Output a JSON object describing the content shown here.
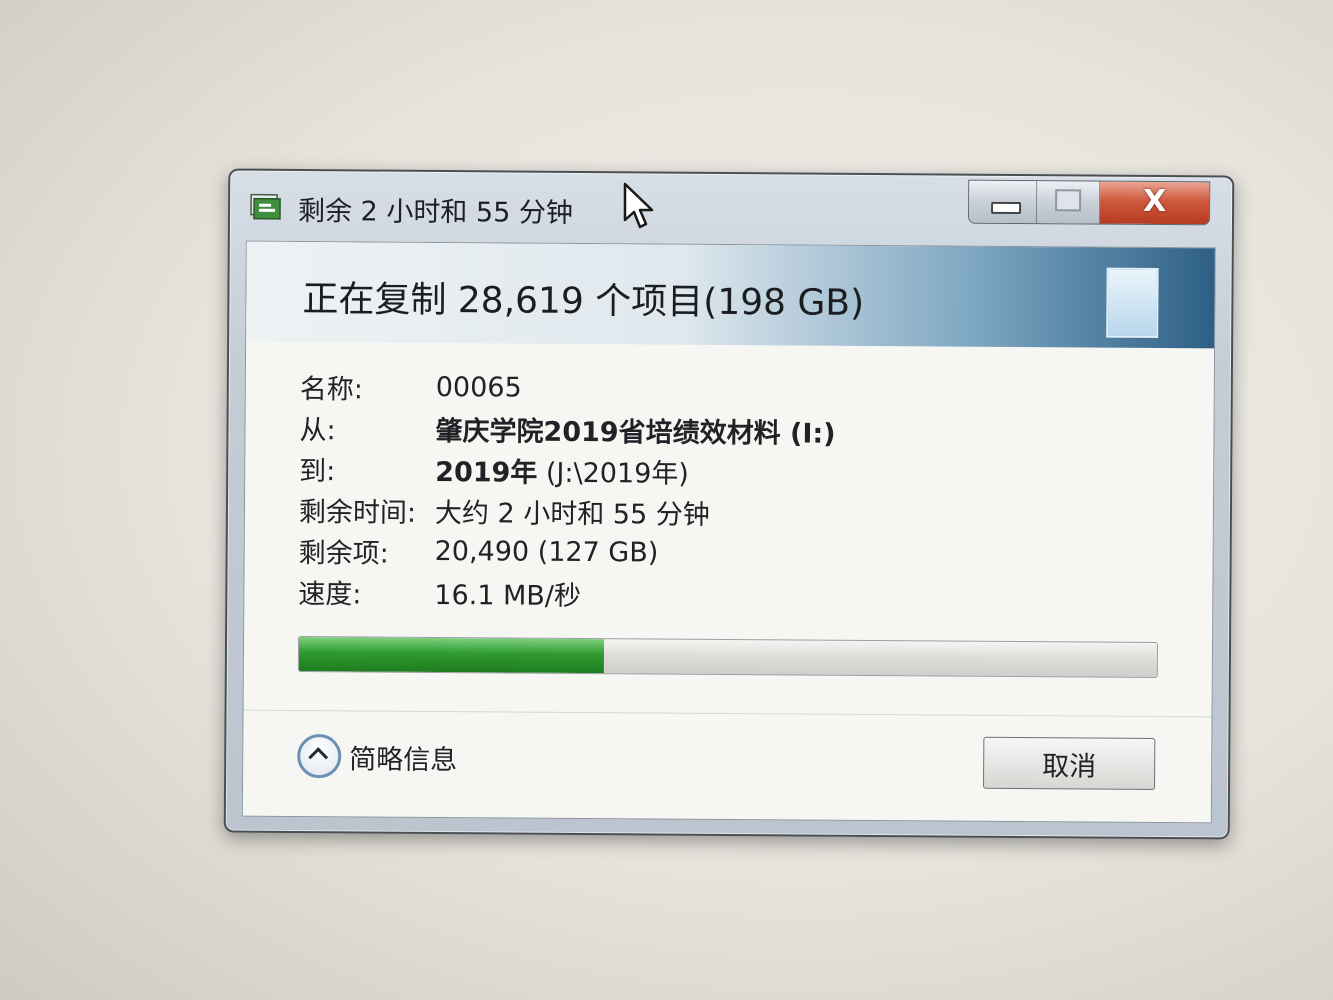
{
  "window": {
    "title": "剩余 2 小时和 55 分钟",
    "header_title": "正在复制 28,619 个项目(198 GB)",
    "close_glyph": "X"
  },
  "details": {
    "rows": [
      {
        "label": "名称:",
        "value": "00065",
        "bold": ""
      },
      {
        "label": "从:",
        "value": "",
        "bold": "肇庆学院2019省培绩效材料 (I:)"
      },
      {
        "label": "到:",
        "value": " (J:\\2019年)",
        "bold": "2019年"
      },
      {
        "label": "剩余时间:",
        "value": "大约 2 小时和 55 分钟",
        "bold": ""
      },
      {
        "label": "剩余项:",
        "value": "20,490 (127 GB)",
        "bold": ""
      },
      {
        "label": "速度:",
        "value": "16.1 MB/秒",
        "bold": ""
      }
    ]
  },
  "progress": {
    "fraction": 0.355
  },
  "footer": {
    "brief_label": "简略信息",
    "cancel_label": "取消"
  },
  "colors": {
    "progress_fill": "#2f9a2f",
    "close_button": "#cf5a3e"
  },
  "icons": {
    "app": "copy-files-icon",
    "minimize": "minimize-icon",
    "maximize": "maximize-icon",
    "close": "close-icon",
    "brief_toggle": "chevron-up-icon",
    "header": "document-icon",
    "cursor": "mouse-pointer-icon"
  }
}
